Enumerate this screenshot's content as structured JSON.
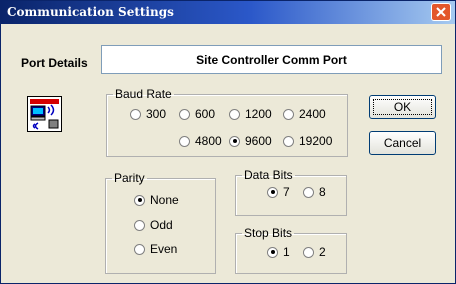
{
  "window": {
    "title": "Communication Settings"
  },
  "port": {
    "label": "Port Details",
    "value": "Site Controller Comm Port"
  },
  "baud": {
    "legend": "Baud Rate",
    "options": [
      "300",
      "600",
      "1200",
      "2400",
      "4800",
      "9600",
      "19200"
    ],
    "selected": "9600"
  },
  "parity": {
    "legend": "Parity",
    "options": [
      "None",
      "Odd",
      "Even"
    ],
    "selected": "None"
  },
  "data_bits": {
    "legend": "Data Bits",
    "options": [
      "7",
      "8"
    ],
    "selected": "7"
  },
  "stop_bits": {
    "legend": "Stop Bits",
    "options": [
      "1",
      "2"
    ],
    "selected": "1"
  },
  "buttons": {
    "ok": "OK",
    "cancel": "Cancel"
  }
}
